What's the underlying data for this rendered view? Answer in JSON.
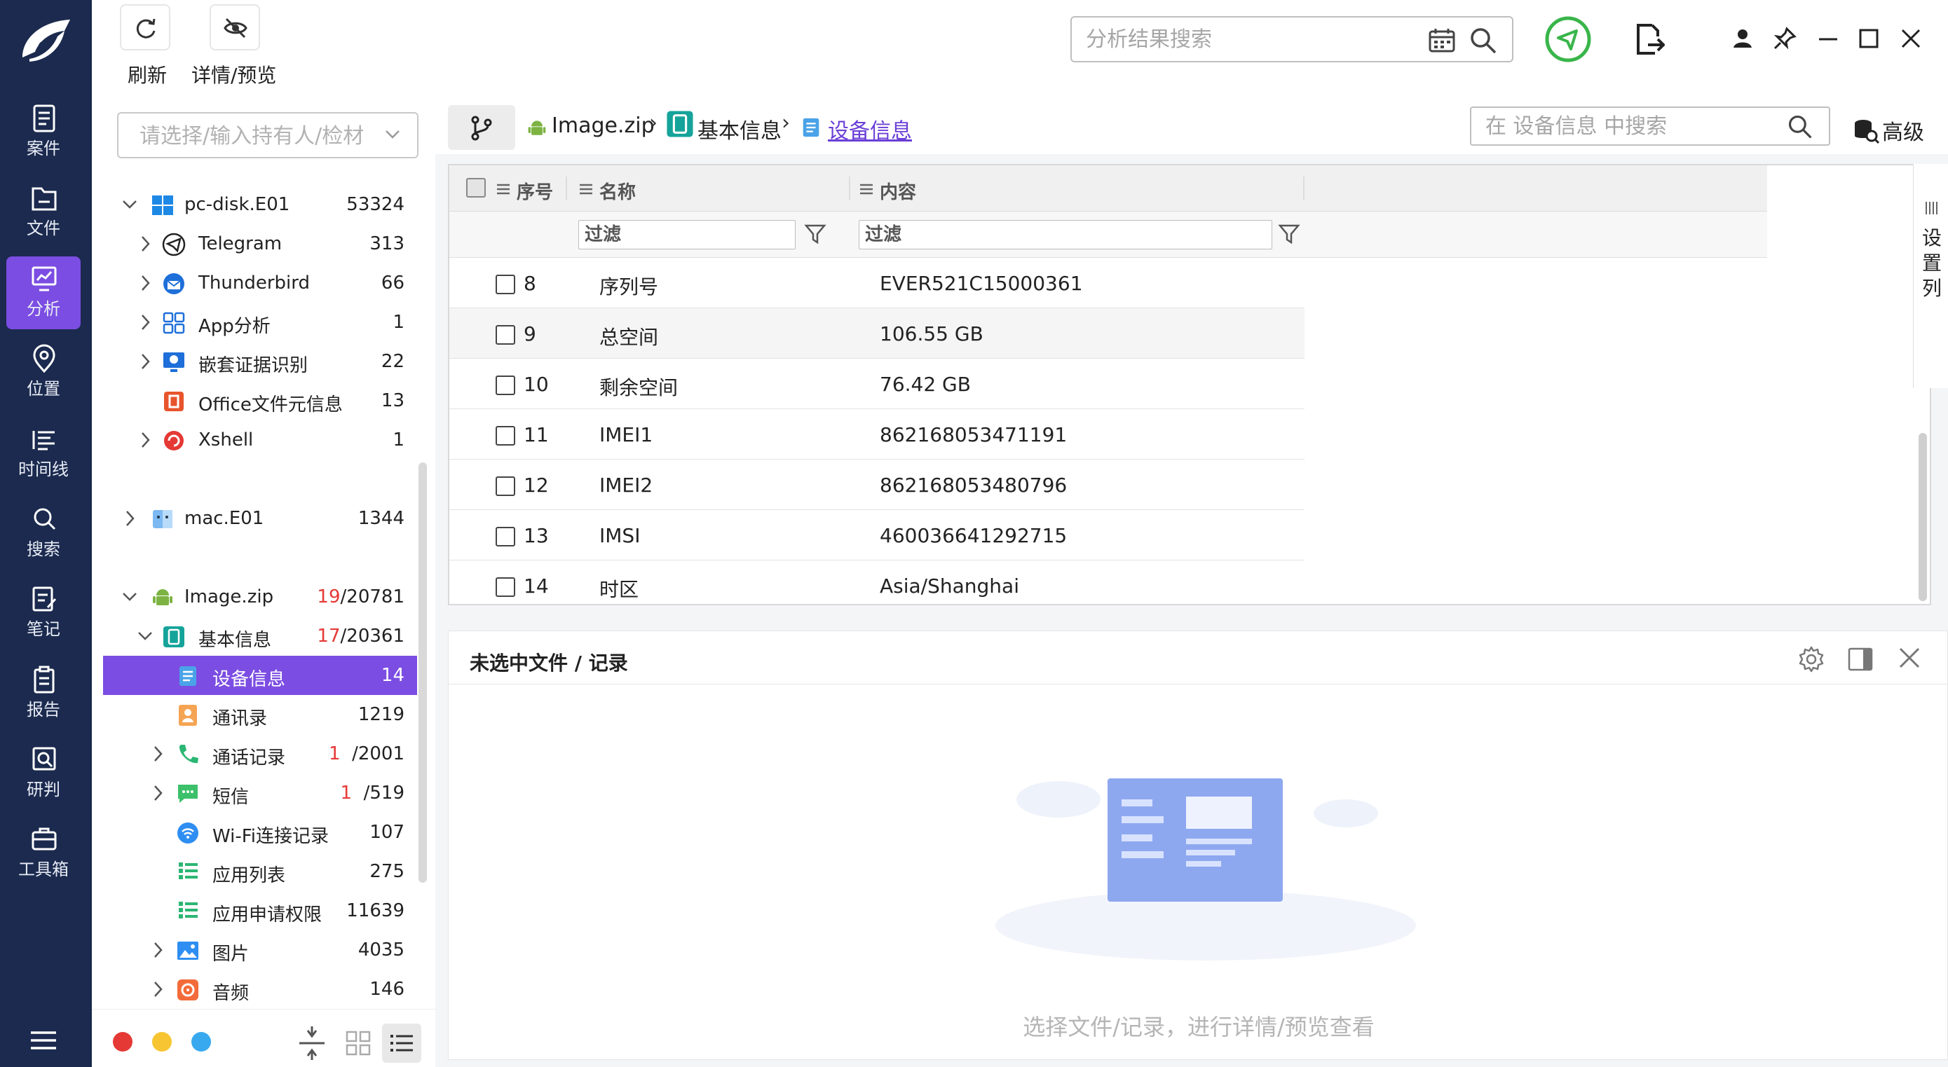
{
  "nav": {
    "items": [
      {
        "label": "案件"
      },
      {
        "label": "文件"
      },
      {
        "label": "分析"
      },
      {
        "label": "位置"
      },
      {
        "label": "时间线"
      },
      {
        "label": "搜索"
      },
      {
        "label": "笔记"
      },
      {
        "label": "报告"
      },
      {
        "label": "研判"
      },
      {
        "label": "工具箱"
      }
    ],
    "active": "分析"
  },
  "toolbar": {
    "refresh_label": "刷新",
    "detail_preview_label": "详情/预览",
    "search_placeholder": "分析结果搜索"
  },
  "tree": {
    "owner_placeholder": "请选择/输入持有人/检材",
    "rows": [
      {
        "name": "pc-disk.E01",
        "count": "53324"
      },
      {
        "name": "Telegram",
        "count": "313"
      },
      {
        "name": "Thunderbird",
        "count": "66"
      },
      {
        "name": "App分析",
        "count": "1"
      },
      {
        "name": "嵌套证据识别",
        "count": "22"
      },
      {
        "name": "Office文件元信息",
        "count": "13"
      },
      {
        "name": "Xshell",
        "count": "1"
      },
      {
        "name": "mac.E01",
        "count": "1344"
      },
      {
        "name": "Image.zip",
        "count_red": "19",
        "count_rest": "/20781"
      },
      {
        "name": "基本信息",
        "count_red": "17",
        "count_rest": "/20361"
      },
      {
        "name": "设备信息",
        "count": "14"
      },
      {
        "name": "通讯录",
        "count": "1219"
      },
      {
        "name": "通话记录",
        "count_red": "1",
        "count_rest": "/2001"
      },
      {
        "name": "短信",
        "count_red": "1",
        "count_rest": "/519"
      },
      {
        "name": "Wi-Fi连接记录",
        "count": "107"
      },
      {
        "name": "应用列表",
        "count": "275"
      },
      {
        "name": "应用申请权限",
        "count": "11639"
      },
      {
        "name": "图片",
        "count": "4035"
      },
      {
        "name": "音频",
        "count": "146"
      }
    ],
    "status_colors": [
      "#e53935",
      "#f7c531",
      "#39a9ef"
    ]
  },
  "path": {
    "crumbs": [
      "Image.zip",
      "基本信息",
      "设备信息"
    ],
    "search_placeholder": "在 设备信息 中搜索",
    "advanced_label": "高级"
  },
  "table": {
    "columns": [
      "序号",
      "名称",
      "内容"
    ],
    "filter_placeholder": "过滤",
    "rows": [
      {
        "no": "8",
        "name": "序列号",
        "value": "EVER521C15000361"
      },
      {
        "no": "9",
        "name": "总空间",
        "value": "106.55 GB"
      },
      {
        "no": "10",
        "name": "剩余空间",
        "value": "76.42 GB"
      },
      {
        "no": "11",
        "name": "IMEI1",
        "value": "862168053471191"
      },
      {
        "no": "12",
        "name": "IMEI2",
        "value": "862168053480796"
      },
      {
        "no": "13",
        "name": "IMSI",
        "value": "460036641292715"
      },
      {
        "no": "14",
        "name": "时区",
        "value": "Asia/Shanghai"
      }
    ],
    "set_columns_label": "设置列"
  },
  "detail": {
    "title": "未选中文件 / 记录",
    "empty_text": "选择文件/记录，进行详情/预览查看"
  },
  "colors": {
    "nav_bg": "#1b2a4e",
    "accent": "#7b4de2",
    "red": "#e53935"
  }
}
